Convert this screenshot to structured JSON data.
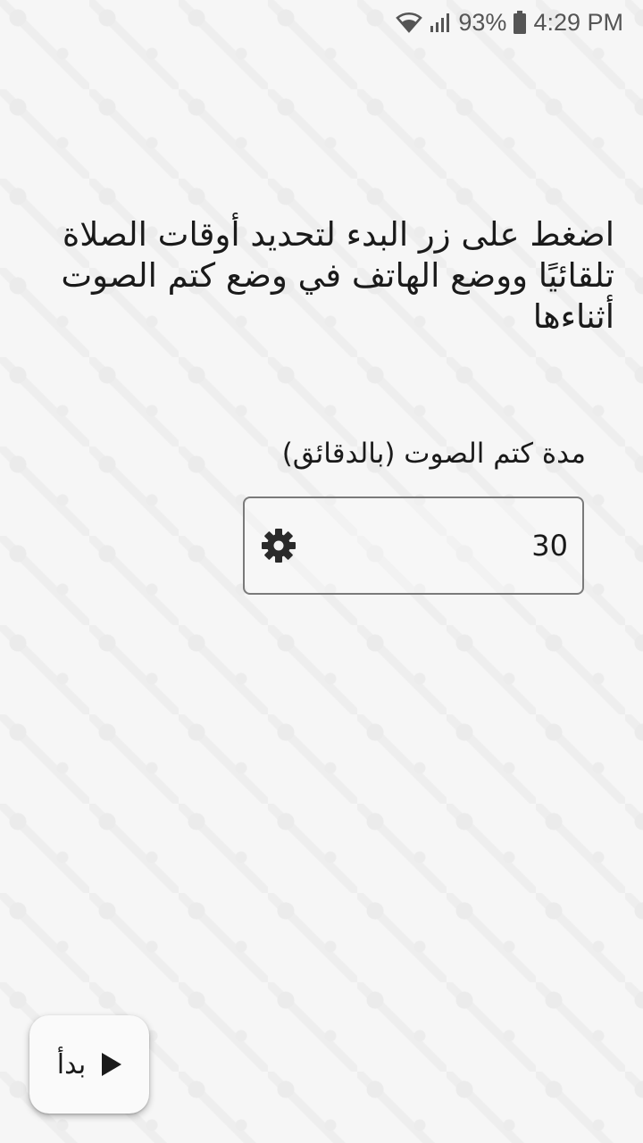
{
  "status_bar": {
    "battery_percent": "93%",
    "time": "4:29 PM",
    "icons": [
      "wifi-icon",
      "signal-icon",
      "battery-icon"
    ]
  },
  "instructions": {
    "text": "اضغط على زر البدء لتحديد أوقات الصلاة تلقائيًا ووضع الهاتف في وضع كتم الصوت أثناءها"
  },
  "mute_duration": {
    "label": "مدة كتم الصوت (بالدقائق)",
    "value": "30",
    "settings_icon": "gear-icon"
  },
  "start_button": {
    "label": "بدأ",
    "icon": "play-icon"
  }
}
